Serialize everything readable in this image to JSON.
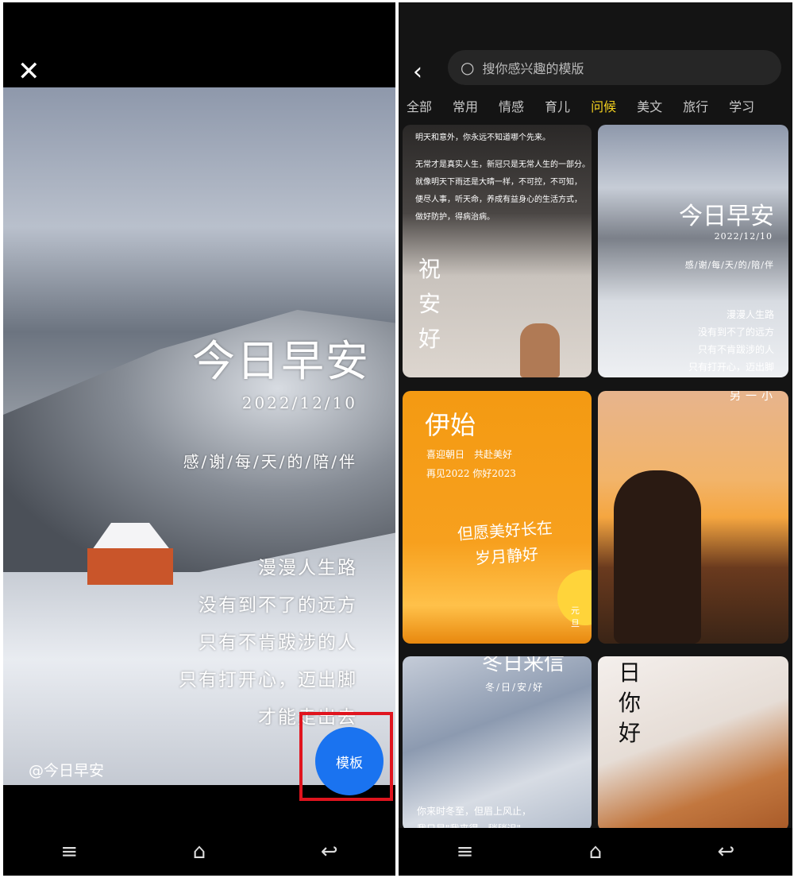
{
  "left": {
    "poster": {
      "title": "今日早安",
      "date": "2022/12/10",
      "thanks": "感/谢/每/天/的/陪/伴",
      "lines": [
        "漫漫人生路",
        "没有到不了的远方",
        "只有不肯跋涉的人",
        "只有打开心，迈出脚",
        "才能走出去"
      ],
      "handle": "@今日早安"
    },
    "template_button": "模板",
    "highlight_color": "#e0141e",
    "accent": "#1a73f0"
  },
  "right": {
    "search_placeholder": "搜你感兴趣的模版",
    "tabs": [
      "全部",
      "常用",
      "情感",
      "育儿",
      "问候",
      "美文",
      "旅行",
      "学习"
    ],
    "active_tab": "问候",
    "cards": [
      {
        "lines": [
          "明天和意外，你永远不知道哪个先来。",
          "无常才是真实人生，新冠只是无常人生的一部分。",
          "就像明天下雨还是大晴一样，不可控，不可知，",
          "便尽人事，听天命，养成有益身心的生活方式，",
          "做好防护，得病治病。"
        ],
        "big": "祝安好"
      },
      {
        "title": "今日早安",
        "date": "2022/12/10",
        "thanks": "感/谢/每/天/的/陪/伴",
        "lines": [
          "漫漫人生路",
          "没有到不了的远方",
          "只有不肯跋涉的人",
          "只有打开心，迈出脚"
        ]
      },
      {
        "title": "伊始",
        "lines": [
          "喜迎朝日　共赴美好",
          "再见2022  你好2023"
        ],
        "wish": [
          "但愿美好长在",
          "岁月静好"
        ],
        "tag": "元旦"
      },
      {
        "title": "另一小"
      },
      {
        "title": "冬日来信",
        "sub": "冬/日/安/好",
        "lines": [
          "你来时冬至，但眉上风止，",
          "我只是\"我来得，稍稍迟\""
        ]
      },
      {
        "big": "日你好"
      }
    ]
  },
  "nav": {
    "menu": "≡",
    "home": "⌂",
    "back": "↩"
  }
}
